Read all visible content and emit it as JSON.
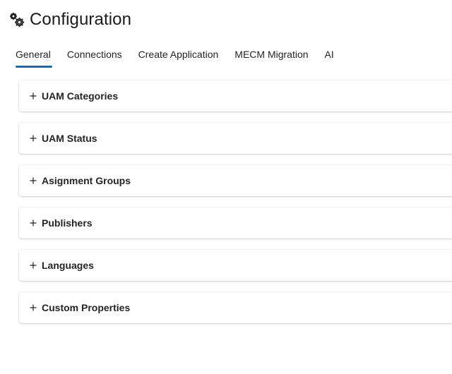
{
  "header": {
    "title": "Configuration",
    "icon": "gears-icon"
  },
  "tabs": [
    {
      "label": "General",
      "active": true
    },
    {
      "label": "Connections",
      "active": false
    },
    {
      "label": "Create Application",
      "active": false
    },
    {
      "label": "MECM Migration",
      "active": false
    },
    {
      "label": "AI",
      "active": false
    }
  ],
  "sections": [
    {
      "label": "UAM Categories",
      "expanded": false
    },
    {
      "label": "UAM Status",
      "expanded": false
    },
    {
      "label": "Asignment Groups",
      "expanded": false
    },
    {
      "label": "Publishers",
      "expanded": false
    },
    {
      "label": "Languages",
      "expanded": false
    },
    {
      "label": "Custom Properties",
      "expanded": false
    }
  ],
  "colors": {
    "accent": "#0f6cbd",
    "text": "#242424"
  }
}
